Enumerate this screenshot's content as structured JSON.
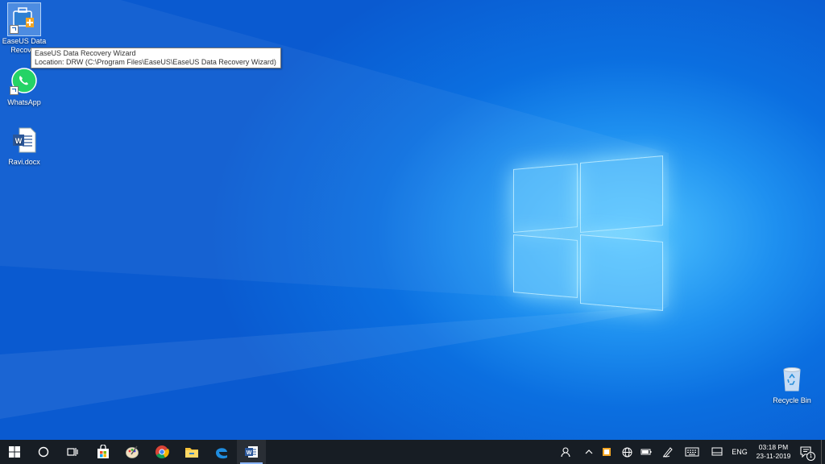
{
  "desktop": {
    "icons": [
      {
        "label": "EaseUS Data Recovery Wizard",
        "icon": "easeus-icon"
      },
      {
        "label": "WhatsApp",
        "icon": "whatsapp-icon"
      },
      {
        "label": "Ravi.docx",
        "icon": "word-document-icon"
      },
      {
        "label": "Recycle Bin",
        "icon": "recycle-bin-icon"
      }
    ],
    "icon_truncated_label": "EaseUS Data Recover",
    "tooltip": {
      "title": "EaseUS Data Recovery Wizard",
      "location": "Location: DRW (C:\\Program Files\\EaseUS\\EaseUS Data Recovery Wizard)"
    }
  },
  "taskbar": {
    "buttons": [
      "start-icon",
      "search-icon",
      "task-view-icon",
      "store-icon",
      "paint-icon",
      "chrome-icon",
      "file-explorer-icon",
      "edge-icon",
      "word-icon"
    ],
    "active": "word-icon",
    "tray": {
      "language": "ENG",
      "time": "03:18 PM",
      "date": "23-11-2019",
      "notification_count": "1"
    }
  },
  "colors": {
    "taskbar": "#171d24",
    "desktop_accent": "#1e90f0"
  }
}
